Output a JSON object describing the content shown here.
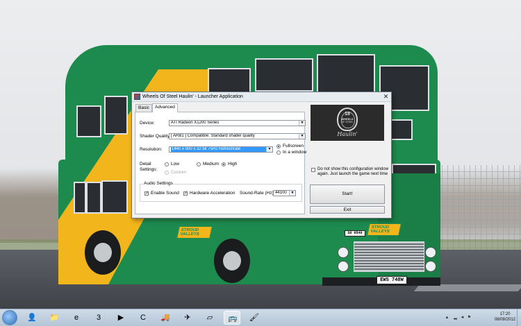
{
  "window": {
    "title": "Wheels Of Steel Haulin' - Launcher Application",
    "close_glyph": "✕",
    "tabs": [
      {
        "label": "Basic",
        "active": false
      },
      {
        "label": "Advanced",
        "active": true
      }
    ],
    "device": {
      "label": "Device:",
      "value": "ATI Radeon X1200 Series"
    },
    "shader_quality": {
      "label": "Shader Quality:",
      "value": "[ ARB1 ]   Compatible:  Standard shader quality"
    },
    "resolution": {
      "label": "Resolution:",
      "value": "1440 x 900 x 32 bit 75Hz Refreshrate",
      "mode_options": [
        {
          "label": "Fullscreen",
          "selected": true
        },
        {
          "label": "In a window",
          "selected": false
        }
      ]
    },
    "detail": {
      "label_line1": "Detail",
      "label_line2": "Settings:",
      "options": [
        {
          "label": "Low",
          "selected": false,
          "enabled": true
        },
        {
          "label": "Medium",
          "selected": false,
          "enabled": true
        },
        {
          "label": "High",
          "selected": true,
          "enabled": true
        },
        {
          "label": "Custom",
          "selected": false,
          "enabled": false
        }
      ]
    },
    "audio": {
      "group_label": "Audio Settings",
      "enable_sound": {
        "label": "Enable Sound",
        "checked": true
      },
      "hardware_acceleration": {
        "label": "Hardware Acceleration",
        "checked": true
      },
      "sound_rate": {
        "label": "Sound-Rate (Hz)",
        "value": "44100"
      }
    },
    "dont_show": {
      "checked": false,
      "line1": "Do not show this configuration window",
      "line2": "again.  Just launch the game next time"
    },
    "start_button": "Start!",
    "exit_button": "Exit"
  },
  "logo": {
    "number": "18",
    "line1": "WHEELS",
    "line2": "OF STEEL",
    "script": "Haulin'"
  },
  "wallpaper": {
    "plate": "EWS 748W",
    "small_plate": "SU 6540",
    "livery_text": "STROUD VALLEYS"
  },
  "taskbar": {
    "apps": [
      {
        "icon": "user-folder-icon",
        "glyph": "👤"
      },
      {
        "icon": "explorer-folder-icon",
        "glyph": "📁"
      },
      {
        "icon": "internet-explorer-icon",
        "glyph": "e"
      },
      {
        "icon": "three-network-icon",
        "glyph": "3"
      },
      {
        "icon": "media-player-icon",
        "glyph": "▶"
      },
      {
        "icon": "ccleaner-icon",
        "glyph": "C"
      },
      {
        "icon": "truck-game-icon",
        "glyph": "🚚"
      },
      {
        "icon": "flight-sim-icon",
        "glyph": "✈"
      },
      {
        "icon": "app-window-icon",
        "glyph": "▱"
      },
      {
        "icon": "haulin-launcher-icon",
        "glyph": "🚌"
      },
      {
        "icon": "paint-icon",
        "glyph": "🖌"
      }
    ],
    "active_index": 9,
    "clock_time": "17:20",
    "clock_date": "08/08/2012"
  }
}
